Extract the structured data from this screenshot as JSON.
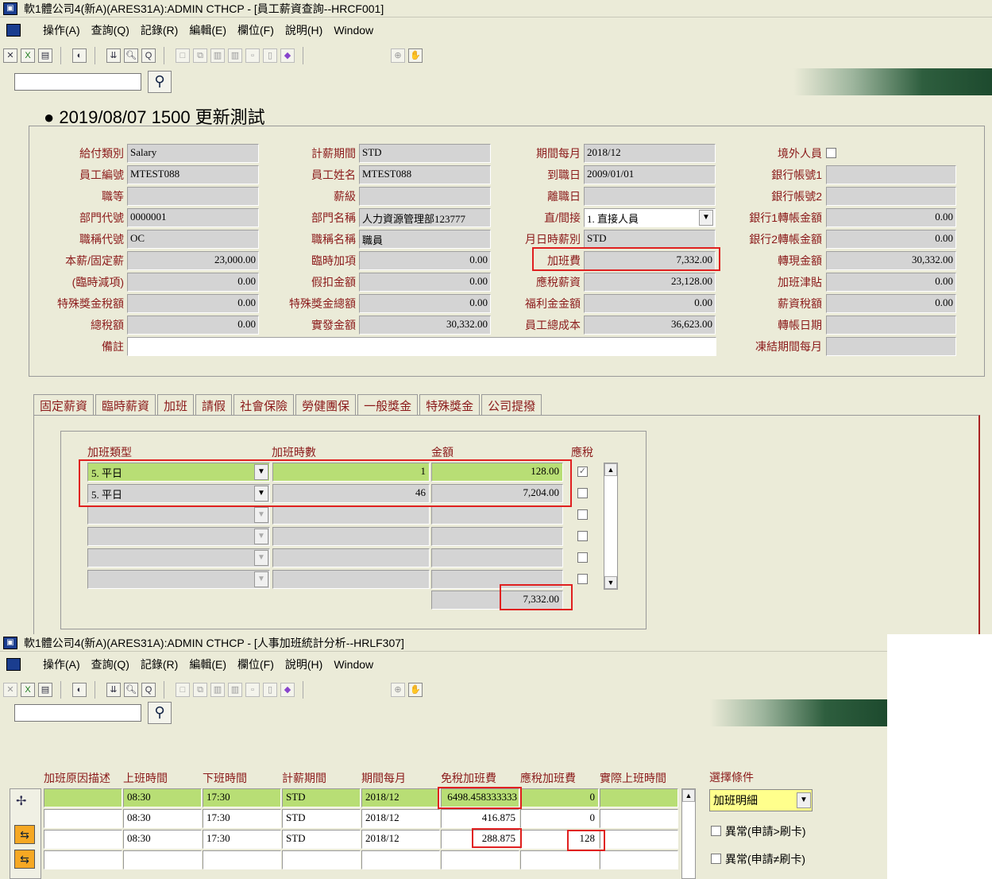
{
  "win1": {
    "title": "軟1體公司4(新A)(ARES31A):ADMIN  CTHCP - [員工薪資查詢--HRCF001]",
    "menu": [
      "操作(A)",
      "查詢(Q)",
      "記錄(R)",
      "編輯(E)",
      "欄位(F)",
      "說明(H)",
      "Window"
    ],
    "heading": "● 2019/08/07 1500 更新測試",
    "col1": {
      "labels": [
        "給付類別",
        "員工編號",
        "職等",
        "部門代號",
        "職稱代號",
        "本薪/固定薪",
        "(臨時減項)",
        "特殊獎金稅額",
        "總稅額",
        "備註"
      ],
      "values": [
        "Salary",
        "MTEST088",
        "",
        "0000001",
        "OC",
        "23,000.00",
        "0.00",
        "0.00",
        "0.00",
        ""
      ]
    },
    "col2": {
      "labels": [
        "計薪期間",
        "員工姓名",
        "薪級",
        "部門名稱",
        "職稱名稱",
        "臨時加項",
        "假扣金額",
        "特殊獎金總額",
        "實發金額"
      ],
      "values": [
        "STD",
        "MTEST088",
        "",
        "人力資源管理部123777",
        "職員",
        "0.00",
        "0.00",
        "0.00",
        "30,332.00"
      ]
    },
    "col3": {
      "labels": [
        "期間每月",
        "到職日",
        "離職日",
        "直/間接",
        "月日時薪別",
        "加班費",
        "應稅薪資",
        "福利金金額",
        "員工總成本"
      ],
      "values": [
        "2018/12",
        "2009/01/01",
        "",
        "1. 直接人員",
        "STD",
        "7,332.00",
        "23,128.00",
        "0.00",
        "36,623.00"
      ]
    },
    "col4": {
      "labels": [
        "境外人員",
        "銀行帳號1",
        "銀行帳號2",
        "銀行1轉帳金額",
        "銀行2轉帳金額",
        "轉現金額",
        "加班津貼",
        "薪資稅額",
        "轉帳日期",
        "凍結期間每月"
      ],
      "values": [
        "",
        "",
        "",
        "0.00",
        "0.00",
        "30,332.00",
        "0.00",
        "0.00",
        "",
        ""
      ]
    },
    "tabs": [
      "固定薪資",
      "臨時薪資",
      "加班",
      "請假",
      "社會保險",
      "勞健團保",
      "一般獎金",
      "特殊獎金",
      "公司提撥"
    ],
    "ot": {
      "headers": [
        "加班類型",
        "加班時數",
        "金額",
        "應稅"
      ],
      "rows": [
        {
          "type": "5. 平日",
          "hours": "1",
          "amount": "128.00"
        },
        {
          "type": "5. 平日",
          "hours": "46",
          "amount": "7,204.00"
        }
      ],
      "total": "7,332.00"
    }
  },
  "win2": {
    "title": "軟1體公司4(新A)(ARES31A):ADMIN  CTHCP - [人事加班統計分析--HRLF307]",
    "menu": [
      "操作(A)",
      "查詢(Q)",
      "記錄(R)",
      "編輯(E)",
      "欄位(F)",
      "說明(H)",
      "Window"
    ],
    "headers": [
      "加班原因描述",
      "上班時間",
      "下班時間",
      "計薪期間",
      "期間每月",
      "免稅加班費",
      "應稅加班費",
      "實際上班時間"
    ],
    "rows": [
      [
        "",
        "08:30",
        "17:30",
        "STD",
        "2018/12",
        "6498.458333333",
        "0",
        ""
      ],
      [
        "",
        "08:30",
        "17:30",
        "STD",
        "2018/12",
        "416.875",
        "0",
        ""
      ],
      [
        "",
        "08:30",
        "17:30",
        "STD",
        "2018/12",
        "288.875",
        "128",
        ""
      ],
      [
        "",
        "",
        "",
        "",
        "",
        "",
        "",
        ""
      ]
    ],
    "filter_label": "選擇條件",
    "filter_value": "加班明細",
    "opt1": "異常(申請>刷卡)",
    "opt2": "異常(申請≠刷卡)"
  }
}
